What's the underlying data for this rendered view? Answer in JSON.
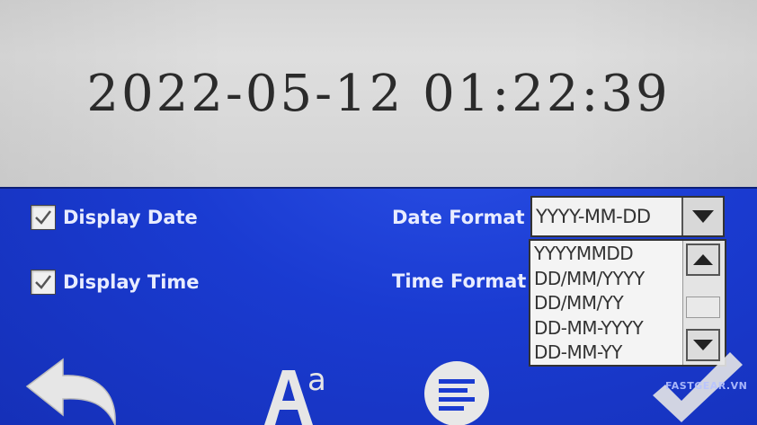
{
  "display": {
    "datetime": "2022-05-12 01:22:39"
  },
  "options": {
    "display_date_label": "Display Date",
    "display_date_checked": true,
    "display_time_label": "Display Time",
    "display_time_checked": true
  },
  "date_format": {
    "label": "Date Format",
    "selected": "YYYY-MM-DD",
    "options": [
      "YYYYMMDD",
      "DD/MM/YYYY",
      "DD/MM/YY",
      "DD-MM-YYYY",
      "DD-MM-YY"
    ]
  },
  "time_format": {
    "label": "Time Format"
  },
  "icons": {
    "back": "back-arrow-icon",
    "font": "font-size-icon",
    "menu": "menu-lines-icon",
    "confirm": "checkmark-icon",
    "dropdown": "dropdown-arrow-icon",
    "scroll_up": "scroll-up-icon",
    "scroll_down": "scroll-down-icon"
  },
  "watermark": "FASTGEAR.VN",
  "colors": {
    "panel_blue": "#1a3bd1",
    "display_gray": "#d8d8d8"
  }
}
